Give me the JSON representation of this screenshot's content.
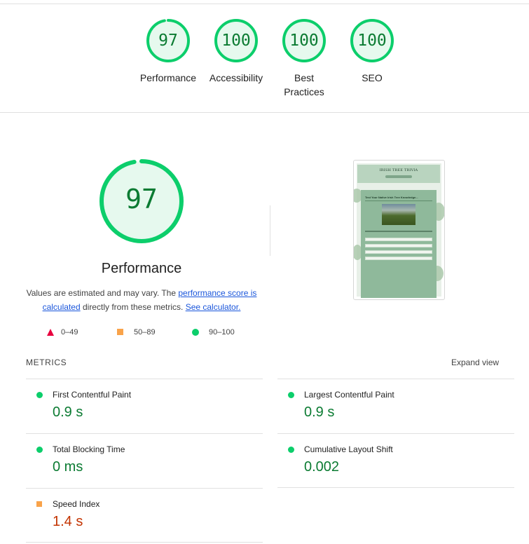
{
  "gauges": [
    {
      "score": "97",
      "label": "Performance",
      "fraction": 0.97
    },
    {
      "score": "100",
      "label": "Accessibility",
      "fraction": 1.0
    },
    {
      "score": "100",
      "label": "Best Practices",
      "fraction": 1.0
    },
    {
      "score": "100",
      "label": "SEO",
      "fraction": 1.0
    }
  ],
  "performance": {
    "score": "97",
    "fraction": 0.97,
    "title": "Performance",
    "desc_prefix": "Values are estimated and may vary. The ",
    "desc_link1": "performance score is calculated",
    "desc_middle": " directly from these metrics. ",
    "desc_link2": "See calculator."
  },
  "legend": {
    "fail": "0–49",
    "average": "50–89",
    "pass": "90–100"
  },
  "screenshot": {
    "site_title": "IRISH TREE TRIVIA",
    "card_title": "Test Your Native Irish Tree Knowledge..."
  },
  "metrics": {
    "heading": "METRICS",
    "expand_label": "Expand view",
    "items": [
      {
        "label": "First Contentful Paint",
        "value": "0.9 s",
        "rating": "pass"
      },
      {
        "label": "Largest Contentful Paint",
        "value": "0.9 s",
        "rating": "pass"
      },
      {
        "label": "Total Blocking Time",
        "value": "0 ms",
        "rating": "pass"
      },
      {
        "label": "Cumulative Layout Shift",
        "value": "0.002",
        "rating": "pass"
      },
      {
        "label": "Speed Index",
        "value": "1.4 s",
        "rating": "average"
      }
    ]
  },
  "colors": {
    "pass": "#0cce6b",
    "pass_text": "#0b7b32",
    "average": "#f9a34a",
    "average_text": "#c33300",
    "fail": "#e8003f",
    "gauge_bg": "#e6f9ee"
  }
}
